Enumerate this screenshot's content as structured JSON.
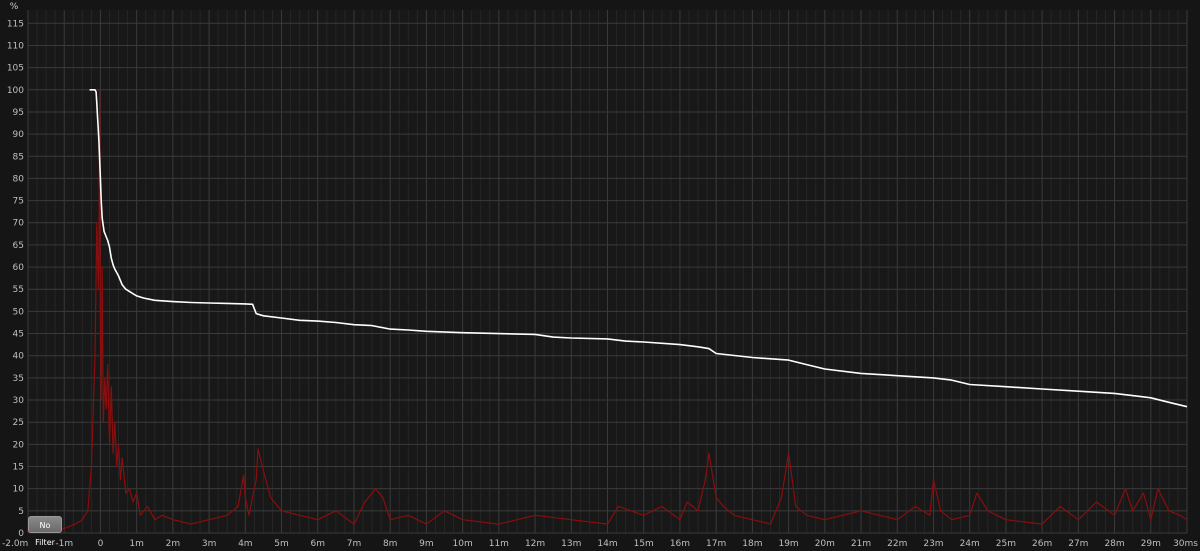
{
  "chart_data": {
    "type": "line",
    "y_unit": "%",
    "xlim": [
      -2.0,
      30
    ],
    "ylim": [
      0,
      118
    ],
    "y_ticks": [
      0,
      5,
      10,
      15,
      20,
      25,
      30,
      35,
      40,
      45,
      50,
      55,
      60,
      65,
      70,
      75,
      80,
      85,
      90,
      95,
      100,
      105,
      110,
      115
    ],
    "x_ticks": [
      {
        "v": -2.0,
        "label": "-2.0m"
      },
      {
        "v": -1,
        "label": "-1m"
      },
      {
        "v": 0,
        "label": "0"
      },
      {
        "v": 1,
        "label": "1m"
      },
      {
        "v": 2,
        "label": "2m"
      },
      {
        "v": 3,
        "label": "3m"
      },
      {
        "v": 4,
        "label": "4m"
      },
      {
        "v": 5,
        "label": "5m"
      },
      {
        "v": 6,
        "label": "6m"
      },
      {
        "v": 7,
        "label": "7m"
      },
      {
        "v": 8,
        "label": "8m"
      },
      {
        "v": 9,
        "label": "9m"
      },
      {
        "v": 10,
        "label": "10m"
      },
      {
        "v": 11,
        "label": "11m"
      },
      {
        "v": 12,
        "label": "12m"
      },
      {
        "v": 13,
        "label": "13m"
      },
      {
        "v": 14,
        "label": "14m"
      },
      {
        "v": 15,
        "label": "15m"
      },
      {
        "v": 16,
        "label": "16m"
      },
      {
        "v": 17,
        "label": "17m"
      },
      {
        "v": 18,
        "label": "18m"
      },
      {
        "v": 19,
        "label": "19m"
      },
      {
        "v": 20,
        "label": "20m"
      },
      {
        "v": 21,
        "label": "21m"
      },
      {
        "v": 22,
        "label": "22m"
      },
      {
        "v": 23,
        "label": "23m"
      },
      {
        "v": 24,
        "label": "24m"
      },
      {
        "v": 25,
        "label": "25m"
      },
      {
        "v": 26,
        "label": "26m"
      },
      {
        "v": 27,
        "label": "27m"
      },
      {
        "v": 28,
        "label": "28m"
      },
      {
        "v": 29,
        "label": "29m"
      },
      {
        "v": 30,
        "label": "30ms"
      }
    ],
    "grid": true,
    "series": [
      {
        "color": "#ffffff",
        "x": [
          -0.3,
          -0.15,
          -0.12,
          -0.1,
          -0.08,
          -0.06,
          -0.04,
          -0.02,
          0,
          0.02,
          0.05,
          0.1,
          0.15,
          0.2,
          0.25,
          0.3,
          0.35,
          0.4,
          0.5,
          0.6,
          0.7,
          0.8,
          0.9,
          1.0,
          1.2,
          1.5,
          2,
          2.5,
          3,
          3.5,
          4,
          4.2,
          4.3,
          4.5,
          5,
          5.5,
          6,
          6.5,
          7,
          7.5,
          8,
          8.5,
          9,
          10,
          11,
          12,
          12.5,
          13,
          14,
          14.5,
          15,
          16,
          16.5,
          16.8,
          17,
          18,
          19,
          19.5,
          20,
          21,
          22,
          23,
          23.5,
          24,
          25,
          26,
          27,
          28,
          29,
          29.5,
          30
        ],
        "y": [
          100,
          100,
          99.5,
          97,
          94,
          91,
          88,
          84,
          80,
          75,
          71,
          68,
          67,
          66,
          64.5,
          62,
          60.5,
          59.5,
          58,
          56,
          55,
          54.5,
          54,
          53.5,
          53,
          52.5,
          52.2,
          52,
          51.9,
          51.8,
          51.7,
          51.6,
          49.5,
          49,
          48.5,
          48,
          47.8,
          47.5,
          47,
          46.8,
          46,
          45.8,
          45.5,
          45.2,
          45,
          44.8,
          44.2,
          44,
          43.8,
          43.3,
          43.1,
          42.5,
          42,
          41.6,
          40.5,
          39.6,
          39,
          38,
          37,
          36,
          35.5,
          35,
          34.5,
          33.5,
          33,
          32.5,
          32,
          31.5,
          30.5,
          29.5,
          28.5
        ]
      },
      {
        "color": "#8b0d0d",
        "x": [
          -2.0,
          -1.5,
          -1.0,
          -0.7,
          -0.5,
          -0.35,
          -0.25,
          -0.15,
          -0.1,
          -0.06,
          -0.04,
          -0.02,
          0,
          0.02,
          0.05,
          0.08,
          0.12,
          0.16,
          0.2,
          0.25,
          0.3,
          0.35,
          0.4,
          0.45,
          0.5,
          0.55,
          0.6,
          0.7,
          0.8,
          0.9,
          1.0,
          1.1,
          1.3,
          1.5,
          1.7,
          2,
          2.5,
          3,
          3.5,
          3.8,
          3.95,
          4,
          4.1,
          4.3,
          4.35,
          4.5,
          4.7,
          5,
          5.5,
          6,
          6.5,
          7,
          7.3,
          7.6,
          7.8,
          8,
          8.5,
          9,
          9.5,
          10,
          11,
          12,
          13,
          14,
          14.3,
          15,
          15.5,
          16,
          16.2,
          16.5,
          16.7,
          16.8,
          17,
          17.2,
          17.5,
          18,
          18.5,
          18.8,
          19,
          19.2,
          19.5,
          20,
          21,
          22,
          22.5,
          22.9,
          23,
          23.2,
          23.5,
          24,
          24.2,
          24.5,
          25,
          26,
          26.5,
          27,
          27.5,
          28,
          28.3,
          28.5,
          28.8,
          29,
          29.2,
          29.5,
          29.8,
          30
        ],
        "y": [
          0,
          0.5,
          1,
          2,
          3,
          5,
          15,
          40,
          70,
          55,
          65,
          100,
          45,
          30,
          60,
          25,
          35,
          28,
          38,
          20,
          33,
          18,
          25,
          15,
          20,
          12,
          17,
          9,
          10,
          7,
          9,
          4,
          6,
          3,
          4,
          3,
          2,
          3,
          4,
          6,
          13,
          8,
          4,
          12,
          19,
          14,
          8,
          5,
          4,
          3,
          5,
          2,
          7,
          10,
          8,
          3,
          4,
          2,
          5,
          3,
          2,
          4,
          3,
          2,
          6,
          4,
          6,
          3,
          7,
          5,
          12,
          18,
          8,
          6,
          4,
          3,
          2,
          8,
          18,
          6,
          4,
          3,
          5,
          3,
          6,
          4,
          12,
          5,
          3,
          4,
          9,
          5,
          3,
          2,
          6,
          3,
          7,
          4,
          10,
          5,
          9,
          3,
          10,
          5,
          4,
          3
        ]
      }
    ]
  },
  "filter_button": {
    "label": "No Filter"
  }
}
